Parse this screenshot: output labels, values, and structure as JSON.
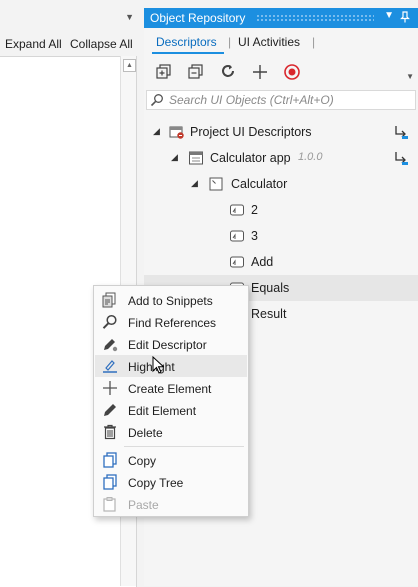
{
  "left_panel": {
    "toolbar": {
      "expand_all": "Expand All",
      "collapse_all": "Collapse All"
    }
  },
  "repo": {
    "title": "Object Repository",
    "tabs": [
      {
        "label": "Descriptors",
        "active": true
      },
      {
        "label": "UI Activities",
        "active": false
      }
    ],
    "toolbar_icons": [
      "add-library-icon",
      "remove-icon",
      "refresh-icon",
      "plus-icon",
      "record-icon"
    ],
    "search": {
      "placeholder": "Search UI Objects (Ctrl+Alt+O)",
      "value": ""
    },
    "tree": [
      {
        "label": "Project UI Descriptors",
        "level": 0,
        "icon": "project-descriptors-icon",
        "expanded": true
      },
      {
        "label": "Calculator app",
        "version": "1.0.0",
        "level": 1,
        "icon": "app-window-icon",
        "expanded": true
      },
      {
        "label": "Calculator",
        "level": 2,
        "icon": "screen-icon",
        "expanded": true
      },
      {
        "label": "2",
        "level": 3,
        "icon": "element-icon"
      },
      {
        "label": "3",
        "level": 3,
        "icon": "element-icon"
      },
      {
        "label": "Add",
        "level": 3,
        "icon": "element-icon"
      },
      {
        "label": "Equals",
        "level": 3,
        "icon": "element-icon",
        "selected": true
      },
      {
        "label": "Result",
        "level": 3,
        "icon": "element-icon"
      }
    ]
  },
  "context_menu": {
    "items": [
      {
        "label": "Add to Snippets",
        "icon": "snippets-icon"
      },
      {
        "label": "Find References",
        "icon": "magnifier-icon"
      },
      {
        "label": "Edit Descriptor",
        "icon": "edit-descriptor-icon"
      },
      {
        "label": "Highlight",
        "icon": "highlight-icon",
        "hovered": true
      },
      {
        "label": "Create Element",
        "icon": "plus-icon"
      },
      {
        "label": "Edit Element",
        "icon": "pencil-icon"
      },
      {
        "label": "Delete",
        "icon": "trash-icon"
      },
      {
        "label": "Copy",
        "icon": "copy-icon"
      },
      {
        "label": "Copy Tree",
        "icon": "copy-tree-icon"
      },
      {
        "label": "Paste",
        "icon": "paste-icon",
        "disabled": true
      }
    ]
  },
  "colors": {
    "accent": "#1c8fe0",
    "record": "#d9262c",
    "selected_row": "#e6e6e6"
  }
}
